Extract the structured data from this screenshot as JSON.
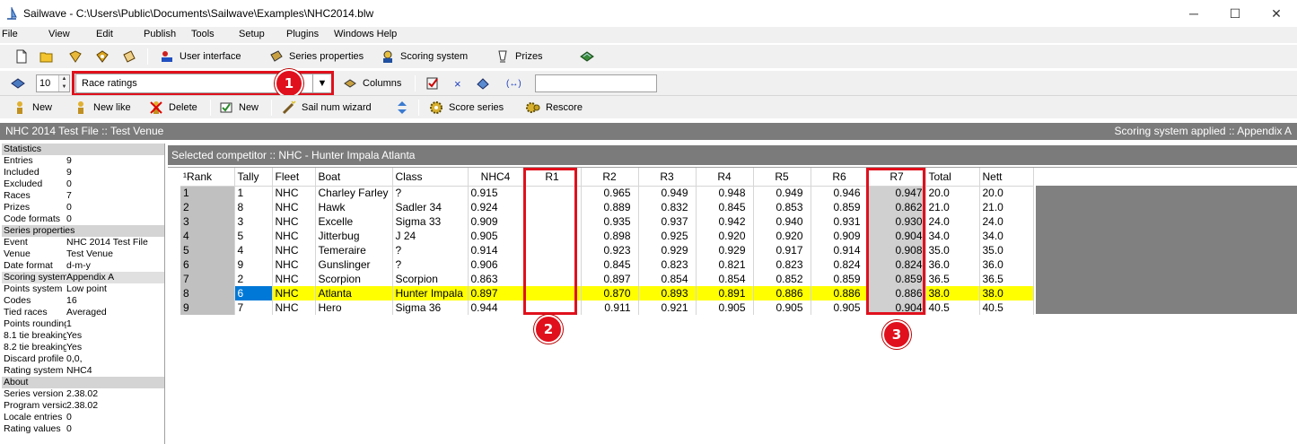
{
  "window": {
    "title": "Sailwave - C:\\Users\\Public\\Documents\\Sailwave\\Examples\\NHC2014.blw",
    "minimize": "─",
    "maximize": "☐",
    "close": "✕"
  },
  "menu": [
    "File",
    "View",
    "Edit",
    "Publish",
    "Tools",
    "Setup",
    "Plugins",
    "Windows Help"
  ],
  "toolbar1": {
    "user_interface": "User interface",
    "series_properties": "Series properties",
    "scoring_system": "Scoring system",
    "prizes": "Prizes"
  },
  "toolbar2": {
    "spin_value": "10",
    "view_value": "Race ratings",
    "columns": "Columns",
    "cross": "×",
    "braces": "(↔)"
  },
  "toolbar3": {
    "new": "New",
    "new_like": "New like",
    "delete": "Delete",
    "new2": "New",
    "sail_num_wizard": "Sail num wizard",
    "score_series": "Score series",
    "rescore": "Rescore"
  },
  "callouts": [
    "1",
    "2",
    "3"
  ],
  "series_band": {
    "left": "NHC 2014 Test File :: Test Venue",
    "right": "Scoring system applied :: Appendix A"
  },
  "selected_band": "Selected competitor :: NHC - Hunter Impala Atlanta",
  "left_panel": [
    {
      "section": "Statistics"
    },
    {
      "k": "Entries",
      "v": "9"
    },
    {
      "k": "Included",
      "v": "9"
    },
    {
      "k": "Excluded",
      "v": "0"
    },
    {
      "k": "Races",
      "v": "7"
    },
    {
      "k": "Prizes",
      "v": "0"
    },
    {
      "k": "Code formats",
      "v": "0"
    },
    {
      "section": "Series properties"
    },
    {
      "k": "Event",
      "v": "NHC 2014 Test File"
    },
    {
      "k": "Venue",
      "v": "Test Venue"
    },
    {
      "k": "Date format",
      "v": "d-m-y"
    },
    {
      "k": "Scoring system",
      "v": "Appendix A",
      "shaded": true
    },
    {
      "k": "Points system",
      "v": "Low point"
    },
    {
      "k": "Codes",
      "v": "16"
    },
    {
      "k": "Tied races",
      "v": "Averaged"
    },
    {
      "k": "Points rounding",
      "v": "1"
    },
    {
      "k": "8.1 tie breaking",
      "v": "Yes"
    },
    {
      "k": "8.2 tie breaking",
      "v": "Yes"
    },
    {
      "k": "Discard profile",
      "v": "0,0,"
    },
    {
      "k": "Rating system",
      "v": "NHC4"
    },
    {
      "section": "About"
    },
    {
      "k": "Series version",
      "v": "2.38.02"
    },
    {
      "k": "Program version",
      "v": "2.38.02"
    },
    {
      "k": "Locale entries",
      "v": "0"
    },
    {
      "k": "Rating values",
      "v": "0"
    }
  ],
  "grid": {
    "headers": [
      "¹Rank",
      "Tally",
      "Fleet",
      "Boat",
      "Class",
      "NHC4",
      "R1",
      "R2",
      "R3",
      "R4",
      "R5",
      "R6",
      "R7",
      "Total",
      "Nett"
    ],
    "rows": [
      [
        "1",
        "1",
        "NHC",
        "Charley Farley",
        "?",
        "0.915",
        "",
        "0.965",
        "0.949",
        "0.948",
        "0.949",
        "0.946",
        "0.947",
        "20.0",
        "20.0"
      ],
      [
        "2",
        "8",
        "NHC",
        "Hawk",
        "Sadler 34",
        "0.924",
        "",
        "0.889",
        "0.832",
        "0.845",
        "0.853",
        "0.859",
        "0.862",
        "21.0",
        "21.0"
      ],
      [
        "3",
        "3",
        "NHC",
        "Excelle",
        "Sigma 33",
        "0.909",
        "",
        "0.935",
        "0.937",
        "0.942",
        "0.940",
        "0.931",
        "0.930",
        "24.0",
        "24.0"
      ],
      [
        "4",
        "5",
        "NHC",
        "Jitterbug",
        "J 24",
        "0.905",
        "",
        "0.898",
        "0.925",
        "0.920",
        "0.920",
        "0.909",
        "0.904",
        "34.0",
        "34.0"
      ],
      [
        "5",
        "4",
        "NHC",
        "Temeraire",
        "?",
        "0.914",
        "",
        "0.923",
        "0.929",
        "0.929",
        "0.917",
        "0.914",
        "0.908",
        "35.0",
        "35.0"
      ],
      [
        "6",
        "9",
        "NHC",
        "Gunslinger",
        "?",
        "0.906",
        "",
        "0.845",
        "0.823",
        "0.821",
        "0.823",
        "0.824",
        "0.824",
        "36.0",
        "36.0"
      ],
      [
        "7",
        "2",
        "NHC",
        "Scorpion",
        "Scorpion",
        "0.863",
        "",
        "0.897",
        "0.854",
        "0.854",
        "0.852",
        "0.859",
        "0.859",
        "36.5",
        "36.5"
      ],
      [
        "8",
        "6",
        "NHC",
        "Atlanta",
        "Hunter Impala",
        "0.897",
        "",
        "0.870",
        "0.893",
        "0.891",
        "0.886",
        "0.886",
        "0.886",
        "38.0",
        "38.0"
      ],
      [
        "9",
        "7",
        "NHC",
        "Hero",
        "Sigma 36",
        "0.944",
        "",
        "0.911",
        "0.921",
        "0.905",
        "0.905",
        "0.905",
        "0.904",
        "40.5",
        "40.5"
      ]
    ],
    "selected_row": 7
  }
}
